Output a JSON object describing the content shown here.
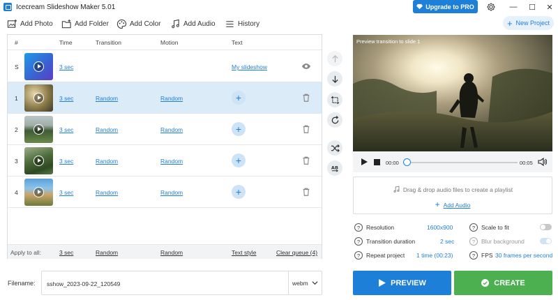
{
  "window": {
    "title": "Icecream Slideshow Maker 5.01",
    "upgrade_label": "Upgrade to PRO",
    "minimize_glyph": "—",
    "maximize_glyph": "☐",
    "close_glyph": "✕"
  },
  "toolbar": {
    "add_photo": "Add Photo",
    "add_folder": "Add Folder",
    "add_color": "Add Color",
    "add_audio": "Add Audio",
    "history": "History",
    "new_project": "New Project"
  },
  "table": {
    "headers": {
      "num": "#",
      "time": "Time",
      "transition": "Transition",
      "motion": "Motion",
      "text": "Text"
    },
    "start_row": {
      "num": "S",
      "time": "3 sec",
      "text": "My slideshow",
      "icon": "eye-icon"
    },
    "rows": [
      {
        "num": "1",
        "time": "3 sec",
        "transition": "Random",
        "motion": "Random",
        "add": "+"
      },
      {
        "num": "2",
        "time": "3 sec",
        "transition": "Random",
        "motion": "Random",
        "add": "+"
      },
      {
        "num": "3",
        "time": "3 sec",
        "transition": "Random",
        "motion": "Random",
        "add": "+"
      },
      {
        "num": "4",
        "time": "3 sec",
        "transition": "Random",
        "motion": "Random",
        "add": "+"
      }
    ],
    "apply_all": {
      "label": "Apply to all:",
      "time": "3 sec",
      "transition": "Random",
      "motion": "Random",
      "text_style": "Text style",
      "clear_queue": "Clear queue (4)"
    }
  },
  "preview": {
    "caption": "Preview transition to slide 1",
    "time_current": "00:00",
    "time_total": "00:05",
    "progress": 0.0
  },
  "audio": {
    "hint": "Drag & drop audio files to create a playlist",
    "add_label": "Add Audio"
  },
  "settings": {
    "resolution_label": "Resolution",
    "resolution_value": "1600x900",
    "transition_duration_label": "Transition duration",
    "transition_duration_value": "2 sec",
    "repeat_label": "Repeat project",
    "repeat_value": "1 time (00:23)",
    "scale_label": "Scale to fit",
    "scale_on": false,
    "blur_label": "Blur background",
    "blur_on": true,
    "fps_label": "FPS",
    "fps_value": "30 frames per second"
  },
  "output": {
    "filename_label": "Filename:",
    "filename": "sshow_2023-09-22_120549",
    "format": "webm",
    "preview_button": "PREVIEW",
    "create_button": "CREATE"
  },
  "colors": {
    "accent": "#1e7fd8",
    "create": "#4caf50",
    "selected_row": "#dcebf8"
  }
}
